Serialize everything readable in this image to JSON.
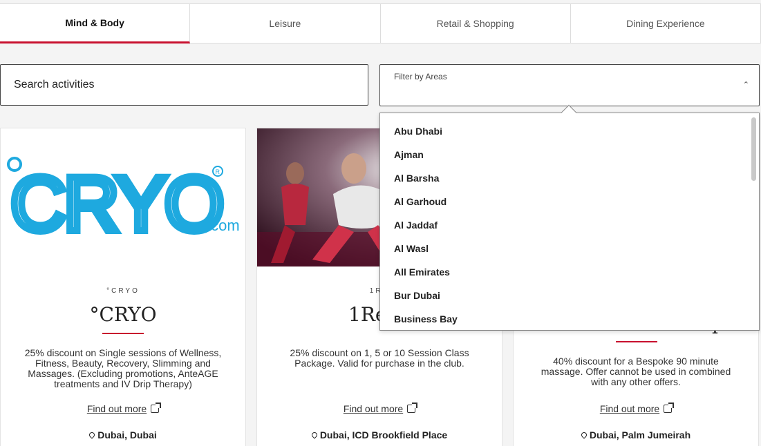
{
  "tabs": [
    {
      "label": "Mind & Body",
      "active": true
    },
    {
      "label": "Leisure",
      "active": false
    },
    {
      "label": "Retail & Shopping",
      "active": false
    },
    {
      "label": "Dining Experience",
      "active": false
    }
  ],
  "search": {
    "placeholder": "Search activities"
  },
  "filter": {
    "label": "Filter by Areas",
    "caret_icon": "chevron-up-icon"
  },
  "areas": [
    "Abu Dhabi",
    "Ajman",
    "Al Barsha",
    "Al Garhoud",
    "Al Jaddaf",
    "Al Wasl",
    "All Emirates",
    "Bur Dubai",
    "Business Bay"
  ],
  "cards": [
    {
      "logo_text": "°CRYO",
      "logo_sub": ".com",
      "logo_reg": "®",
      "brand": "°CRYO",
      "title": "°CRYO",
      "description": "25% discount on Single sessions of Wellness, Fitness, Beauty, Recovery, Slimming and Massages. (Excluding promotions, AnteAGE treatments and IV Drip Therapy)",
      "link": "Find out more",
      "location": "Dubai, Dubai"
    },
    {
      "brand": "1RE",
      "title": "1Rebe",
      "description": "25% discount on 1, 5 or 10 Session Class Package. Valid for purchase in the club.",
      "link": "Find out more",
      "location": "Dubai, ICD Brookfield Place"
    },
    {
      "title": "q",
      "description": "40% discount for a Bespoke 90 minute massage. Offer cannot be used in combined with any other offers.",
      "link": "Find out more",
      "location": "Dubai, Palm Jumeirah"
    }
  ],
  "colors": {
    "accent": "#c8102e",
    "cryo_blue": "#1ea9df"
  }
}
